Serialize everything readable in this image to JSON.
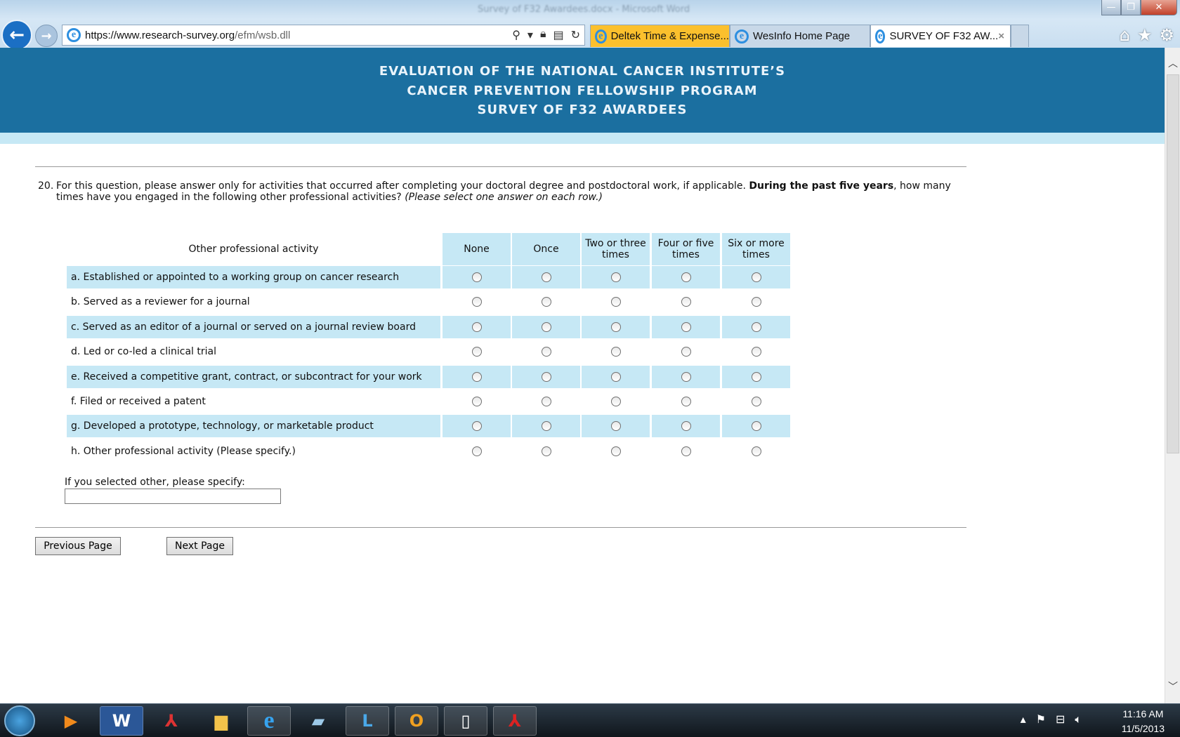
{
  "browser": {
    "window_title": "Survey of F32 Awardees.docx - Microsoft Word",
    "url_host": "https://www.research-survey.org",
    "url_path": "/efm/wsb.dll",
    "tabs": [
      {
        "label": "Deltek Time & Expense...",
        "active": false,
        "color": "#fbc02d"
      },
      {
        "label": "WesInfo Home Page",
        "active": false
      },
      {
        "label": "SURVEY OF F32 AW...",
        "active": true
      }
    ],
    "close_tab_glyph": "×",
    "toolbar_icons": [
      "home-icon",
      "favorites-star-icon",
      "settings-gear-icon"
    ],
    "address_icons": [
      "search-icon",
      "dropdown-icon",
      "lock-icon",
      "compatibility-icon",
      "refresh-icon"
    ]
  },
  "header": {
    "line1": "EVALUATION OF THE NATIONAL CANCER INSTITUTE’S",
    "line2": "CANCER PREVENTION FELLOWSHIP PROGRAM",
    "line3": "SURVEY OF F32 AWARDEES",
    "bg_color": "#1b6fa0",
    "stripe_color": "#c6e8f5"
  },
  "question": {
    "number": "20.",
    "text_part1": "For this question, please answer only for activities that occurred after completing your doctoral degree and postdoctoral work, if applicable. ",
    "text_bold": "During the past five years",
    "text_part2": ", how many times have you engaged in the following other professional activities? ",
    "text_italic": "(Please select one answer on each row.)"
  },
  "grid": {
    "row_header": "Other professional activity",
    "columns": [
      "None",
      "Once",
      "Two or three times",
      "Four or five times",
      "Six or more times"
    ],
    "rows": [
      "a. Established or appointed to a working group on cancer research",
      "b. Served as a reviewer for a journal",
      "c. Served as an editor of a journal or served on a journal review board",
      "d. Led or co-led a clinical trial",
      "e. Received a competitive grant, contract, or subcontract for your work",
      "f. Filed or received a patent",
      "g. Developed a prototype, technology, or marketable product",
      "h. Other professional activity (Please specify.)"
    ]
  },
  "specify": {
    "label": "If you selected other, please specify:",
    "value": ""
  },
  "nav": {
    "previous": "Previous Page",
    "next": "Next Page"
  },
  "taskbar": {
    "apps": [
      "media-player-icon",
      "word-icon",
      "acrobat-icon",
      "file-explorer-icon",
      "internet-explorer-icon",
      "notepad-icon",
      "lync-icon",
      "outlook-icon",
      "blank-document-icon",
      "adobe-reader-icon"
    ],
    "time": "11:16 AM",
    "date": "11/5/2013"
  }
}
